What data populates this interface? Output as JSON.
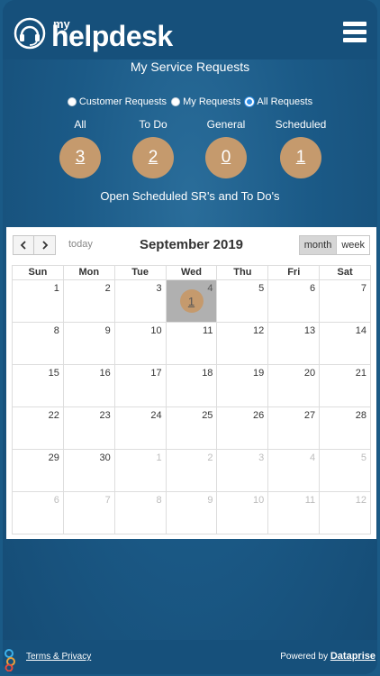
{
  "header": {
    "brand_small": "my",
    "brand_main": "helpdesk"
  },
  "page": {
    "title": "My Service Requests",
    "subtitle": "Open Scheduled SR's and To Do's"
  },
  "filters": [
    {
      "label": "Customer Requests",
      "checked": false
    },
    {
      "label": "My Requests",
      "checked": false
    },
    {
      "label": "All Requests",
      "checked": true
    }
  ],
  "stats": [
    {
      "label": "All",
      "count": "3"
    },
    {
      "label": "To Do",
      "count": "2"
    },
    {
      "label": "General",
      "count": "0"
    },
    {
      "label": "Scheduled",
      "count": "1"
    }
  ],
  "calendar": {
    "title": "September 2019",
    "today_label": "today",
    "month_label": "month",
    "week_label": "week",
    "days_of_week": [
      "Sun",
      "Mon",
      "Tue",
      "Wed",
      "Thu",
      "Fri",
      "Sat"
    ],
    "weeks": [
      [
        "1",
        "2",
        "3",
        "4",
        "5",
        "6",
        "7"
      ],
      [
        "8",
        "9",
        "10",
        "11",
        "12",
        "13",
        "14"
      ],
      [
        "15",
        "16",
        "17",
        "18",
        "19",
        "20",
        "21"
      ],
      [
        "22",
        "23",
        "24",
        "25",
        "26",
        "27",
        "28"
      ],
      [
        "29",
        "30",
        "1",
        "2",
        "3",
        "4",
        "5"
      ],
      [
        "6",
        "7",
        "8",
        "9",
        "10",
        "11",
        "12"
      ]
    ],
    "event_count": "1"
  },
  "footer": {
    "terms": "Terms & Privacy",
    "powered_by": "Powered by",
    "company": "Dataprise"
  }
}
